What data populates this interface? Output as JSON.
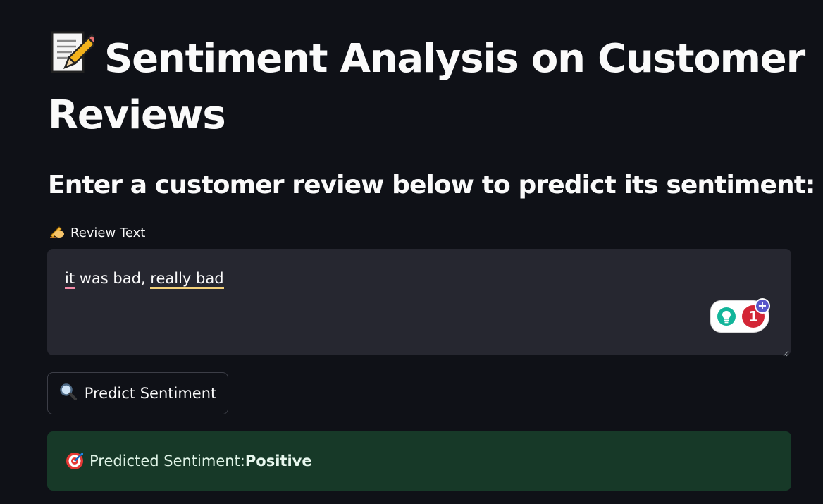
{
  "title": {
    "icon": "memo-pencil-icon",
    "text": "Sentiment Analysis on Customer Reviews"
  },
  "subtitle": "Enter a customer review below to predict its sentiment:",
  "review_field": {
    "icon": "writing-hand-icon",
    "label": "Review Text",
    "value_parts": [
      "it",
      " was bad, ",
      "really bad"
    ]
  },
  "grammar_widget": {
    "count": "1",
    "plus": "+"
  },
  "predict_button": {
    "icon": "magnifier-icon",
    "label": "Predict Sentiment"
  },
  "result": {
    "icon": "target-icon",
    "label": "Predicted Sentiment: ",
    "value": "Positive",
    "color": "#173928"
  },
  "colors": {
    "background": "#0f1117",
    "input_bg": "#262730",
    "success_bg": "#173928",
    "text": "#fafafa"
  }
}
